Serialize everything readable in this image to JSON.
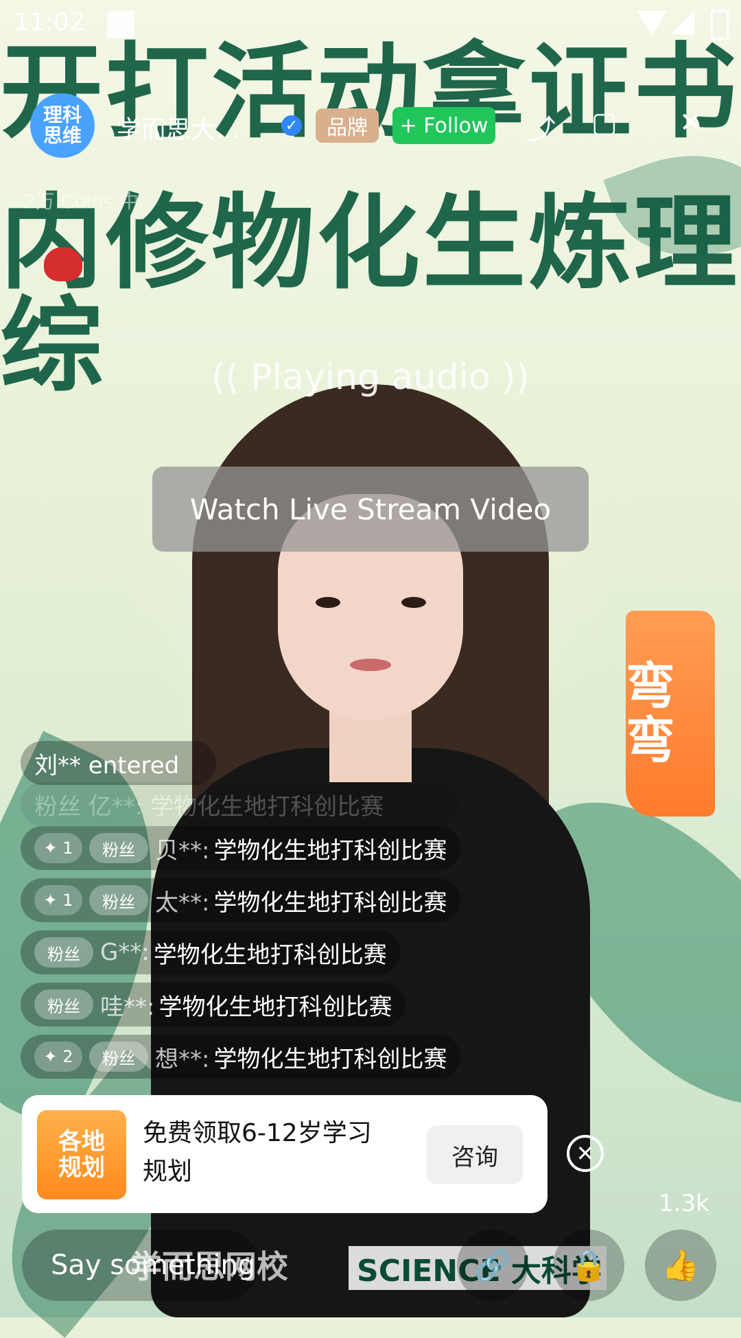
{
  "status_bar": {
    "time": "11:02"
  },
  "header": {
    "avatar_text": "理科\n思维",
    "streamer_name": "学而思大…",
    "brand_label": "品牌",
    "follow_label": "+ Follow",
    "coins_text": "2万 Coins 中",
    "icons": [
      "share-icon",
      "window-icon",
      "close-icon"
    ]
  },
  "background": {
    "headline_1": "开打活动拿证书",
    "headline_2": "内修物化生炼理综",
    "right_tag": "弯弯"
  },
  "audio": {
    "label": "((  Playing audio  ))"
  },
  "watch_button": {
    "label": "Watch Live Stream Video"
  },
  "chat": {
    "entered": "刘** entered",
    "faded": "粉丝  亿**: 学物化生地打科创比赛",
    "rows": [
      {
        "level": "✦ 1",
        "badge": "粉丝",
        "user": "贝**:",
        "message": "学物化生地打科创比赛"
      },
      {
        "level": "✦ 1",
        "badge": "粉丝",
        "user": "太**:",
        "message": "学物化生地打科创比赛"
      },
      {
        "badge": "粉丝",
        "user": "G**:",
        "message": "学物化生地打科创比赛"
      },
      {
        "badge": "粉丝",
        "user": "哇**:",
        "message": "学物化生地打科创比赛"
      },
      {
        "level": "✦ 2",
        "badge": "粉丝",
        "user": "想**:",
        "message": "学物化生地打科创比赛"
      }
    ]
  },
  "ad": {
    "image_text": "各地\n规划",
    "text": "免费领取6-12岁学习规划",
    "button": "咨询"
  },
  "likes": "1.3k",
  "bottom": {
    "say_placeholder": "Say something",
    "logo_text": "学而思网校",
    "science_text": "SCIENCE 大科学"
  }
}
